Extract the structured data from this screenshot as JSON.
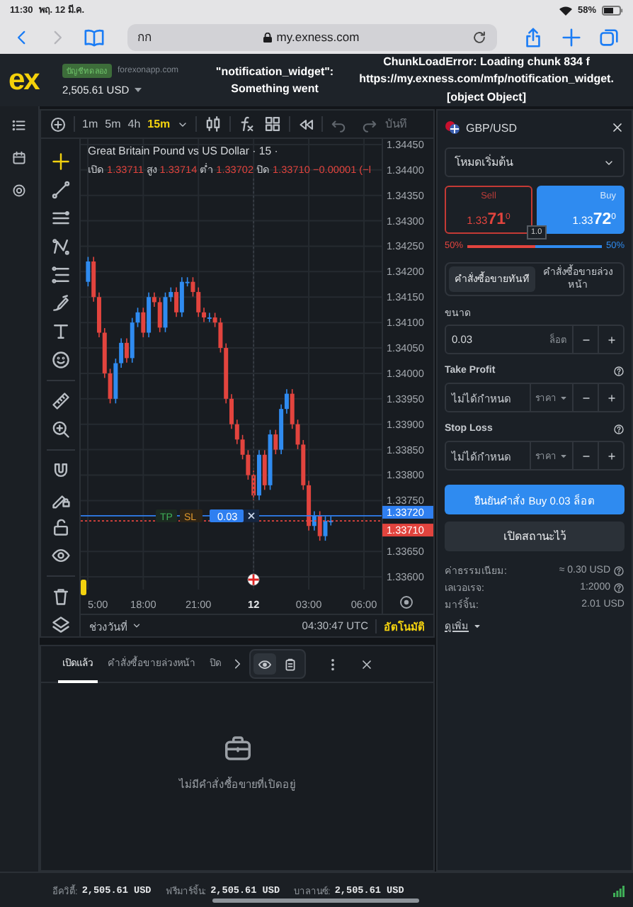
{
  "status_bar": {
    "time": "11:30",
    "date": "พฤ. 12 มี.ค.",
    "battery": "58%"
  },
  "browser": {
    "reader_label": "กก",
    "url": "my.exness.com"
  },
  "header": {
    "logo": "ex",
    "account_badge": "บัญชีทดลอง",
    "domain": "forexonapp.com",
    "balance": "2,505.61 USD",
    "widget_error": [
      "\"notification_widget\":",
      "Something went"
    ],
    "chunk_error": [
      "ChunkLoadError: Loading chunk 834 f",
      "https://my.exness.com/mfp/notification_widget.",
      "[object Object]"
    ]
  },
  "chart": {
    "timeframes": [
      {
        "label": "1m",
        "selected": false
      },
      {
        "label": "5m",
        "selected": false
      },
      {
        "label": "4h",
        "selected": false
      },
      {
        "label": "15m",
        "selected": true
      }
    ],
    "save_label": "บันทึ",
    "title": "Great Britain Pound vs US Dollar · 15 ·",
    "ohlc": [
      {
        "label": "เปิด",
        "value": "1.33711"
      },
      {
        "label": "สูง",
        "value": "1.33714"
      },
      {
        "label": "ต่ำ",
        "value": "1.33702"
      },
      {
        "label": "ปิด",
        "value": "1.33710"
      }
    ],
    "change": "−0.00001 (−l",
    "chart_data": {
      "type": "candlestick",
      "x": [
        15,
        15.3,
        15.6,
        15.9,
        16.2,
        16.5,
        16.8,
        17.1,
        17.4,
        17.7,
        18,
        18.3,
        18.6,
        18.9,
        19.2,
        19.5,
        19.8,
        20.1,
        20.4,
        20.7,
        21,
        21.3,
        21.6,
        21.9,
        22.2,
        22.5,
        22.8,
        23.1,
        23.4,
        23.7,
        24,
        24.3,
        24.6,
        24.9,
        25.2,
        25.5,
        25.8,
        26.1,
        26.4,
        26.7,
        27,
        27.3,
        27.6,
        27.9,
        28.2
      ],
      "ohlc": [
        [
          1.3418,
          1.34229,
          1.34171,
          1.3422
        ],
        [
          1.3422,
          1.34229,
          1.34141,
          1.3415
        ],
        [
          1.3415,
          1.34159,
          1.34071,
          1.3408
        ],
        [
          1.3408,
          1.34089,
          1.33991,
          1.34
        ],
        [
          1.34,
          1.34009,
          1.33941,
          1.3395
        ],
        [
          1.3395,
          1.34029,
          1.33941,
          1.3402
        ],
        [
          1.3402,
          1.34069,
          1.34011,
          1.3406
        ],
        [
          1.3406,
          1.34069,
          1.34021,
          1.3403
        ],
        [
          1.3403,
          1.34109,
          1.34021,
          1.341
        ],
        [
          1.341,
          1.34129,
          1.34091,
          1.3412
        ],
        [
          1.3412,
          1.34129,
          1.34071,
          1.3408
        ],
        [
          1.3408,
          1.34159,
          1.34071,
          1.3415
        ],
        [
          1.3415,
          1.34159,
          1.34131,
          1.3414
        ],
        [
          1.3414,
          1.34149,
          1.34081,
          1.3409
        ],
        [
          1.3409,
          1.34159,
          1.34081,
          1.3415
        ],
        [
          1.3415,
          1.34169,
          1.34141,
          1.3416
        ],
        [
          1.3416,
          1.34169,
          1.34111,
          1.3412
        ],
        [
          1.3412,
          1.34189,
          1.34111,
          1.3418
        ],
        [
          1.3418,
          1.34189,
          1.34171,
          1.3418
        ],
        [
          1.3418,
          1.34189,
          1.34151,
          1.3416
        ],
        [
          1.3416,
          1.34169,
          1.34111,
          1.3412
        ],
        [
          1.3412,
          1.34129,
          1.34101,
          1.3411
        ],
        [
          1.3411,
          1.34119,
          1.34101,
          1.3411
        ],
        [
          1.3411,
          1.34119,
          1.34091,
          1.341
        ],
        [
          1.341,
          1.34109,
          1.34041,
          1.3405
        ],
        [
          1.3405,
          1.34059,
          1.33941,
          1.3395
        ],
        [
          1.3395,
          1.33959,
          1.33891,
          1.339
        ],
        [
          1.339,
          1.33909,
          1.33861,
          1.3387
        ],
        [
          1.3387,
          1.33879,
          1.33831,
          1.3384
        ],
        [
          1.3384,
          1.33849,
          1.33791,
          1.338
        ],
        [
          1.338,
          1.33809,
          1.33751,
          1.3376
        ],
        [
          1.3376,
          1.33849,
          1.33751,
          1.3384
        ],
        [
          1.3384,
          1.33849,
          1.33771,
          1.3378
        ],
        [
          1.3378,
          1.33889,
          1.33771,
          1.3388
        ],
        [
          1.3388,
          1.33889,
          1.33841,
          1.3385
        ],
        [
          1.3385,
          1.33939,
          1.33841,
          1.3393
        ],
        [
          1.3393,
          1.33969,
          1.33921,
          1.3396
        ],
        [
          1.3396,
          1.33969,
          1.33891,
          1.339
        ],
        [
          1.339,
          1.33909,
          1.33851,
          1.3386
        ],
        [
          1.3386,
          1.33869,
          1.33771,
          1.3378
        ],
        [
          1.3378,
          1.33789,
          1.33691,
          1.337
        ],
        [
          1.337,
          1.33729,
          1.33691,
          1.3372
        ],
        [
          1.3372,
          1.33729,
          1.33671,
          1.3368
        ],
        [
          1.3368,
          1.33719,
          1.33671,
          1.3371
        ],
        [
          1.3371,
          1.33719,
          1.33701,
          1.3371
        ]
      ],
      "yticks": [
        {
          "value": 1.3445,
          "label": "1.34450"
        },
        {
          "value": 1.344,
          "label": "1.34400"
        },
        {
          "value": 1.3435,
          "label": "1.34350"
        },
        {
          "value": 1.343,
          "label": "1.34300"
        },
        {
          "value": 1.3425,
          "label": "1.34250"
        },
        {
          "value": 1.342,
          "label": "1.34200"
        },
        {
          "value": 1.3415,
          "label": "1.34150"
        },
        {
          "value": 1.341,
          "label": "1.34100"
        },
        {
          "value": 1.3405,
          "label": "1.34050"
        },
        {
          "value": 1.34,
          "label": "1.34000"
        },
        {
          "value": 1.3395,
          "label": "1.33950"
        },
        {
          "value": 1.339,
          "label": "1.33900"
        },
        {
          "value": 1.3385,
          "label": "1.33850"
        },
        {
          "value": 1.338,
          "label": "1.33800"
        },
        {
          "value": 1.3375,
          "label": "1.33750"
        },
        {
          "value": 1.3365,
          "label": "1.33650"
        },
        {
          "value": 1.336,
          "label": "1.33600"
        }
      ],
      "xticks": [
        {
          "value": 18,
          "label": "18:00"
        },
        {
          "value": 21,
          "label": "21:00"
        }
      ],
      "xlim": [
        14.6,
        31
      ],
      "ylim": [
        1.33575,
        1.34461
      ],
      "grid": true,
      "ref_lines": [
        {
          "axis": "y",
          "value": 1.3372,
          "color": "#2f7ff0"
        },
        {
          "axis": "y",
          "value": 1.3371,
          "color": "#e2443e"
        },
        {
          "axis": "x",
          "value": 24,
          "color": "#3a4048"
        }
      ]
    },
    "cut_time_label": "5:00",
    "next_day_labels": [
      "12",
      "03:00",
      "06:00"
    ],
    "price_tags": [
      {
        "kind": "ask",
        "value": "1.33720"
      },
      {
        "kind": "bid",
        "value": "1.33710"
      }
    ],
    "order_line": {
      "tp": "TP",
      "sl": "SL",
      "volume": "0.03"
    },
    "range_label": "ช่วงวันที่",
    "clock": "04:30:47 UTC",
    "auto_label": "อัตโนมัติ"
  },
  "order_panel": {
    "symbol": "GBP/USD",
    "mode": "โหมดเริ่มต้น",
    "sides": [
      {
        "kind": "sell",
        "label": "Sell",
        "price": "1.33**71**$^{0}$",
        "selected": false
      },
      {
        "kind": "buy",
        "label": "Buy",
        "price": "1.33**72**$^{0}$",
        "selected": true
      }
    ],
    "spread": "1.0",
    "sentiment": {
      "sell": "50%",
      "buy": "50%",
      "level": 0.5
    },
    "order_types": [
      {
        "label": "คำสั่งซื้อขายทันที",
        "selected": true
      },
      {
        "label": "คำสั่งซื้อขายล่วงหน้า",
        "selected": false
      }
    ],
    "volume": {
      "label": "ขนาด",
      "value": "0.03",
      "unit": "ล็อต"
    },
    "take_profit": {
      "label": "Take Profit",
      "placeholder": "ไม่ได้กำหนด",
      "unit": "ราคา"
    },
    "stop_loss": {
      "label": "Stop Loss",
      "placeholder": "ไม่ได้กำหนด",
      "unit": "ราคา"
    },
    "confirm_button": "ยืนยันคำสั่ง Buy 0.03 ล็อต",
    "open_button": "เปิดสถานะไว้",
    "info": [
      {
        "label": "ค่าธรรมเนียม:",
        "value": "≈ 0.30 USD",
        "help": true
      },
      {
        "label": "เลเวอเรจ:",
        "value": "1:2000",
        "help": true
      },
      {
        "label": "มาร์จิ้น:",
        "value": "2.01 USD",
        "help": false
      }
    ],
    "more": "ดูเพิ่ม"
  },
  "positions": {
    "tabs": [
      {
        "label": "เปิดแล้ว",
        "selected": true
      },
      {
        "label": "คำสั่งซื้อขายล่วงหน้า",
        "selected": false
      },
      {
        "label": "ปิด",
        "selected": false
      }
    ],
    "view_modes": [
      {
        "kind": "eye",
        "selected": true
      },
      {
        "kind": "clipboard",
        "selected": false
      }
    ],
    "empty_text": "ไม่มีคำสั่งซื้อขายที่เปิดอยู่"
  },
  "footer": {
    "stats": [
      {
        "label": "อีควิตี้:",
        "value": "2,505.61 USD"
      },
      {
        "label": "ฟรีมาร์จิ้น:",
        "value": "2,505.61 USD"
      },
      {
        "label": "บาลานซ์:",
        "value": "2,505.61 USD"
      }
    ]
  }
}
